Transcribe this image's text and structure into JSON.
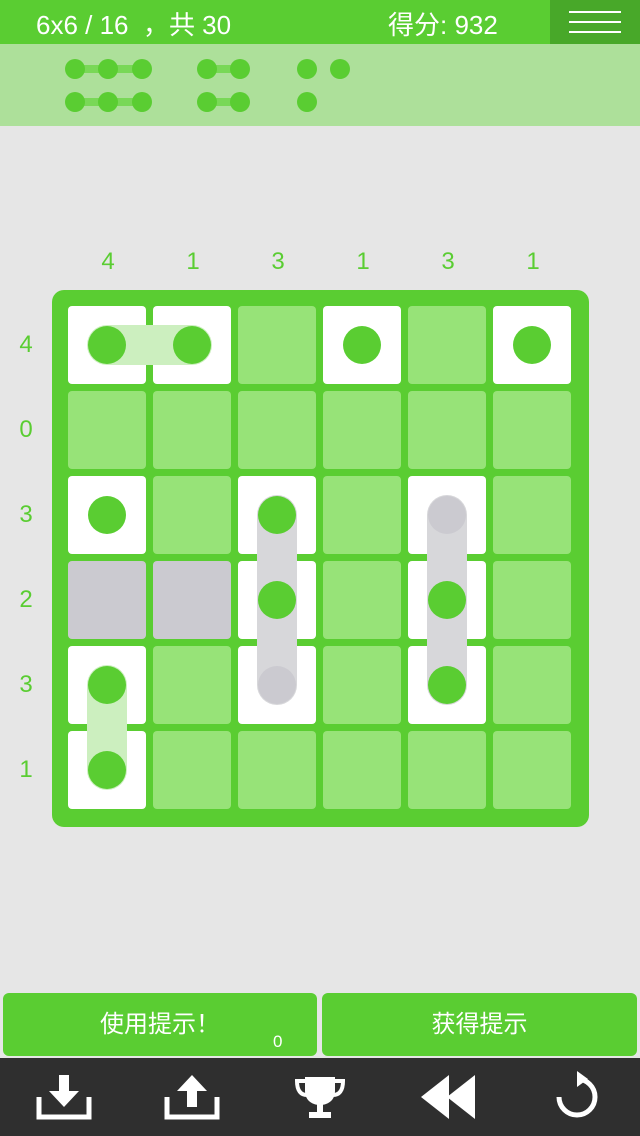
{
  "header": {
    "level_text": "6x6 / 16  ，共 30",
    "score_text": "得分: 932"
  },
  "pieces_palette": [
    {
      "rows": [
        3,
        3
      ],
      "name": "piece-1x3"
    },
    {
      "rows": [
        2,
        2
      ],
      "name": "piece-1x2"
    },
    {
      "rows": [
        2,
        1
      ],
      "name": "piece-single"
    }
  ],
  "board": {
    "size": 6,
    "column_clues": [
      "4",
      "1",
      "3",
      "1",
      "3",
      "1"
    ],
    "row_clues": [
      "4",
      "0",
      "3",
      "2",
      "3",
      "1"
    ],
    "cells": [
      [
        "white",
        "white",
        "empty",
        "white",
        "empty",
        "white"
      ],
      [
        "empty",
        "empty",
        "empty",
        "empty",
        "empty",
        "empty"
      ],
      [
        "white",
        "empty",
        "white",
        "empty",
        "white",
        "empty"
      ],
      [
        "gray",
        "gray",
        "white",
        "empty",
        "white",
        "empty"
      ],
      [
        "white",
        "empty",
        "white",
        "empty",
        "white",
        "empty"
      ],
      [
        "white",
        "empty",
        "empty",
        "empty",
        "empty",
        "empty"
      ]
    ],
    "dots": [
      [
        0,
        0,
        "green"
      ],
      [
        0,
        1,
        "green"
      ],
      [
        0,
        3,
        "green"
      ],
      [
        0,
        5,
        "green"
      ],
      [
        2,
        0,
        "green"
      ],
      [
        2,
        2,
        "green"
      ],
      [
        2,
        4,
        "gray"
      ],
      [
        3,
        2,
        "green"
      ],
      [
        3,
        4,
        "green"
      ],
      [
        4,
        0,
        "green"
      ],
      [
        4,
        2,
        "gray"
      ],
      [
        4,
        4,
        "green"
      ],
      [
        5,
        0,
        "green"
      ]
    ],
    "links": [
      {
        "from": [
          0,
          0
        ],
        "to": [
          0,
          1
        ],
        "color": "green"
      },
      {
        "from": [
          2,
          2
        ],
        "to": [
          4,
          2
        ],
        "color": "gray"
      },
      {
        "from": [
          2,
          4
        ],
        "to": [
          4,
          4
        ],
        "color": "gray"
      },
      {
        "from": [
          4,
          0
        ],
        "to": [
          5,
          0
        ],
        "color": "green"
      }
    ]
  },
  "actions": {
    "use_hint_label": "使用提示！",
    "hint_count": "0",
    "get_hint_label": "获得提示"
  },
  "toolbar": {
    "icons": [
      "download-icon",
      "upload-icon",
      "trophy-icon",
      "rewind-icon",
      "restart-icon"
    ]
  },
  "colors": {
    "accent": "#5acd32",
    "accent_dark": "#48a829",
    "cell_empty": "#97e378",
    "cell_filled": "#ffffff",
    "cell_blocked": "#cbcad0",
    "background": "#e6e6e6",
    "toolbar_bg": "#2f2f2f"
  }
}
